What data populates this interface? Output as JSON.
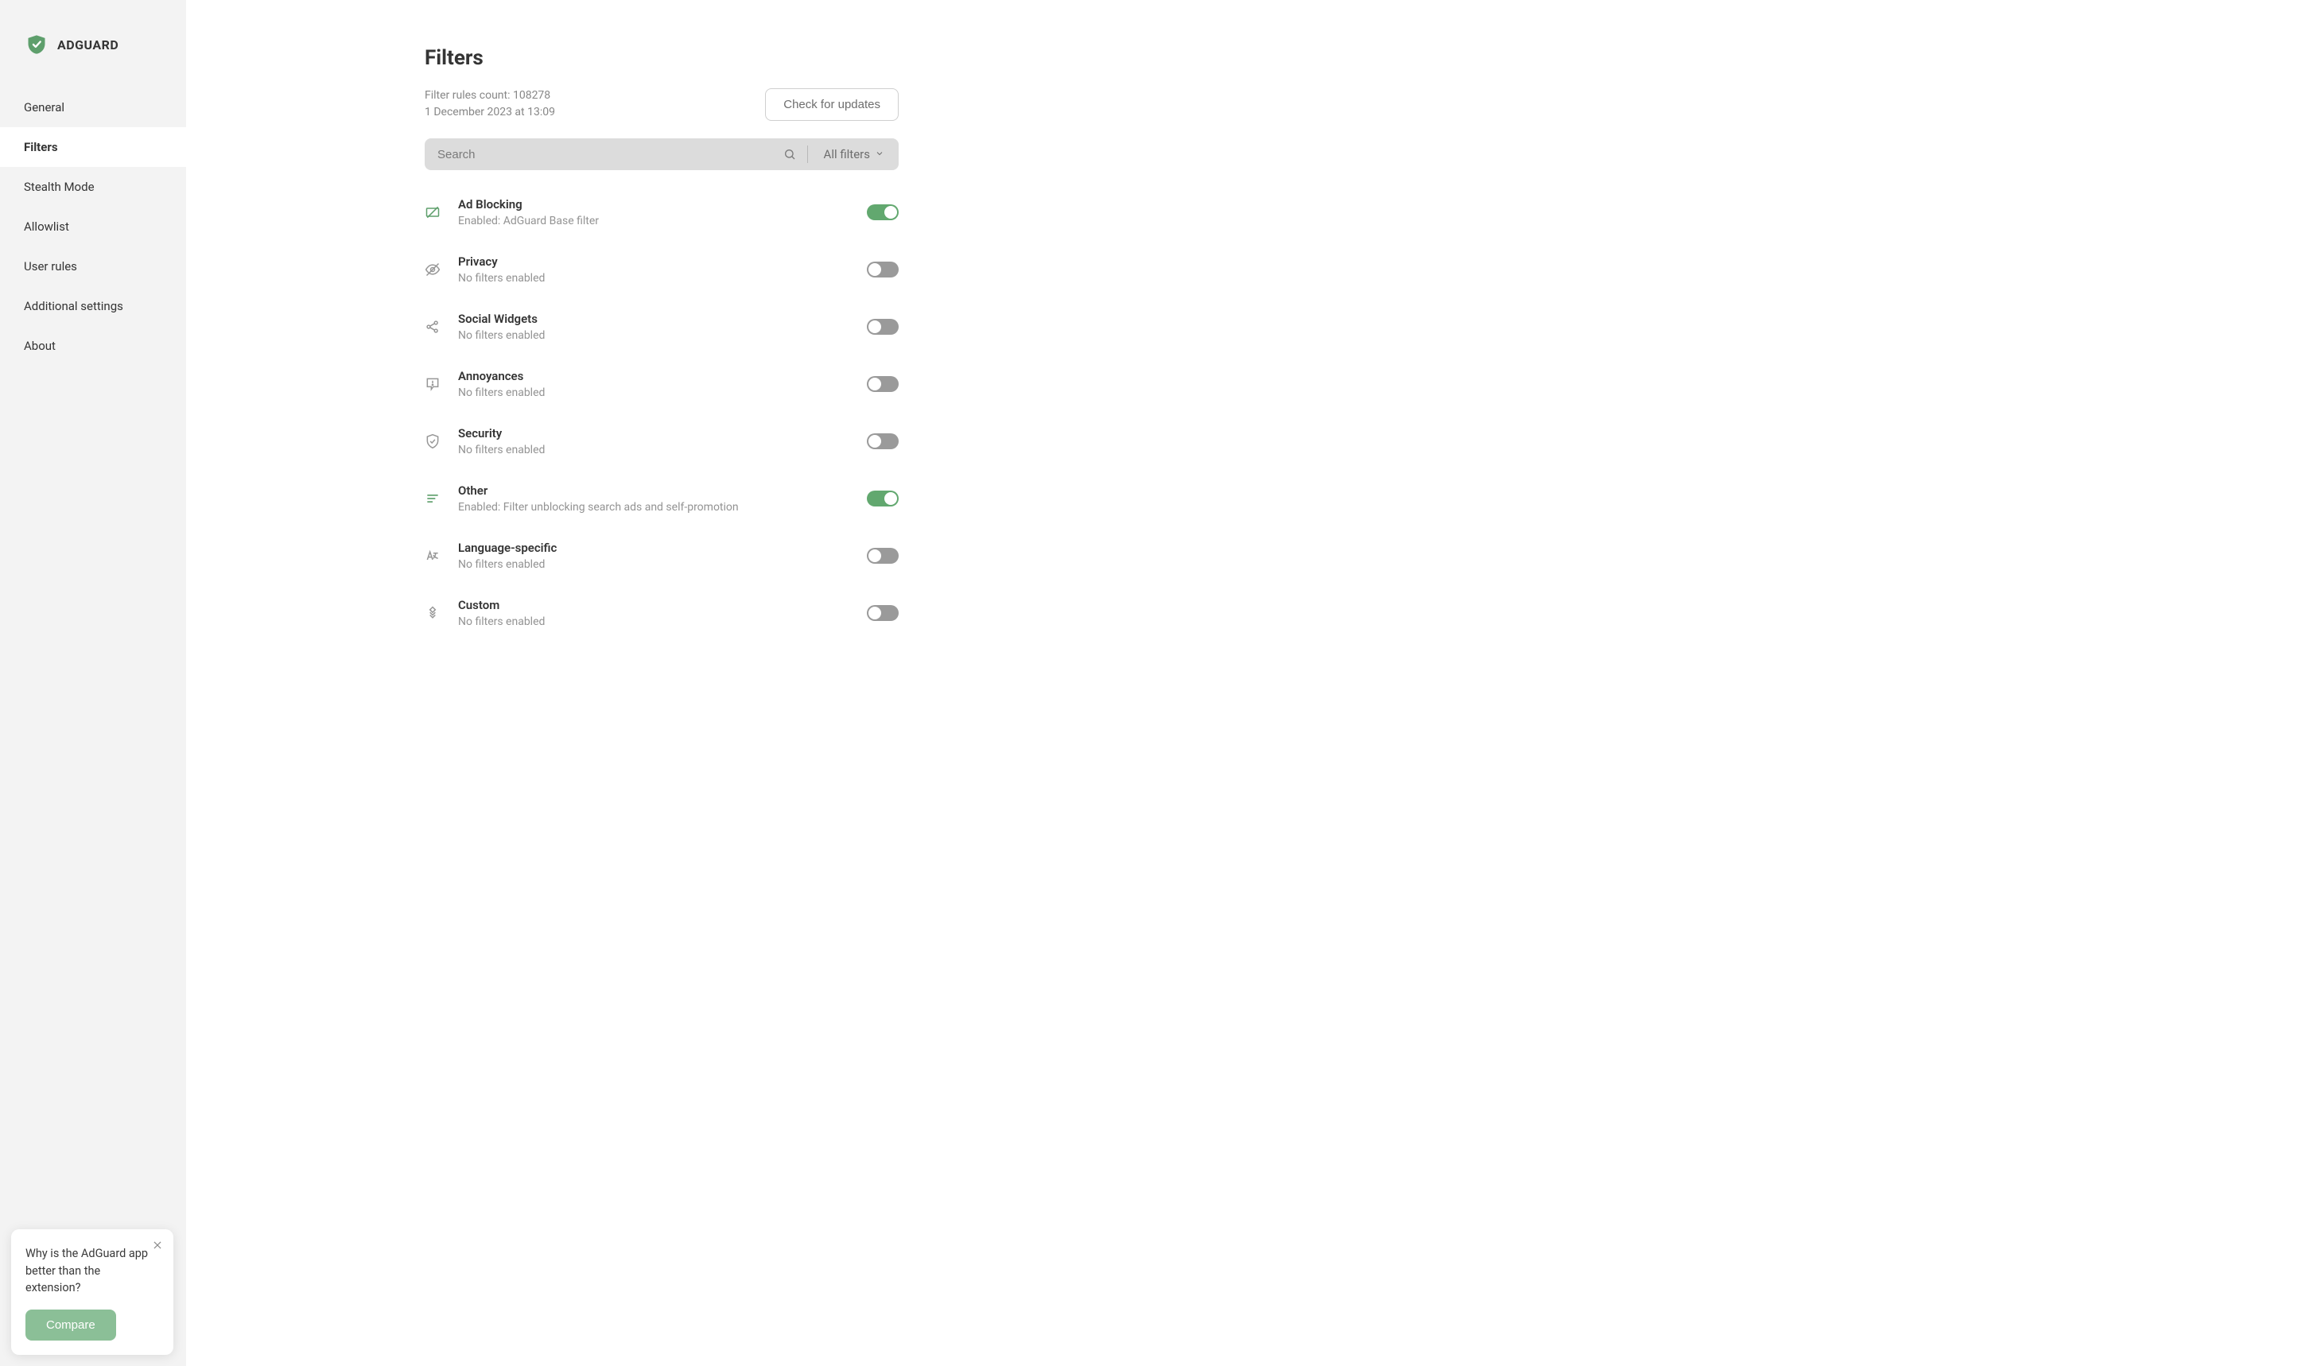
{
  "brand": {
    "name": "ADGUARD"
  },
  "sidebar": {
    "items": [
      {
        "label": "General"
      },
      {
        "label": "Filters"
      },
      {
        "label": "Stealth Mode"
      },
      {
        "label": "Allowlist"
      },
      {
        "label": "User rules"
      },
      {
        "label": "Additional settings"
      },
      {
        "label": "About"
      }
    ],
    "active_index": 1
  },
  "page": {
    "title": "Filters",
    "rules_line": "Filter rules count: 108278",
    "updated_line": "1 December 2023 at 13:09",
    "check_updates": "Check for updates"
  },
  "search": {
    "placeholder": "Search",
    "dropdown_label": "All filters"
  },
  "categories": [
    {
      "icon": "no-ads-icon",
      "icon_green": true,
      "title": "Ad Blocking",
      "subtitle": "Enabled: AdGuard Base filter",
      "enabled": true
    },
    {
      "icon": "eye-off-icon",
      "icon_green": false,
      "title": "Privacy",
      "subtitle": "No filters enabled",
      "enabled": false
    },
    {
      "icon": "share-icon",
      "icon_green": false,
      "title": "Social Widgets",
      "subtitle": "No filters enabled",
      "enabled": false
    },
    {
      "icon": "annoyance-icon",
      "icon_green": false,
      "title": "Annoyances",
      "subtitle": "No filters enabled",
      "enabled": false
    },
    {
      "icon": "shield-icon",
      "icon_green": false,
      "title": "Security",
      "subtitle": "No filters enabled",
      "enabled": false
    },
    {
      "icon": "list-icon",
      "icon_green": true,
      "title": "Other",
      "subtitle": "Enabled: Filter unblocking search ads and self-promotion",
      "enabled": true
    },
    {
      "icon": "language-icon",
      "icon_green": false,
      "title": "Language-specific",
      "subtitle": "No filters enabled",
      "enabled": false
    },
    {
      "icon": "custom-icon",
      "icon_green": false,
      "title": "Custom",
      "subtitle": "No filters enabled",
      "enabled": false
    }
  ],
  "promo": {
    "text": "Why is the AdGuard app better than the extension?",
    "button": "Compare"
  }
}
